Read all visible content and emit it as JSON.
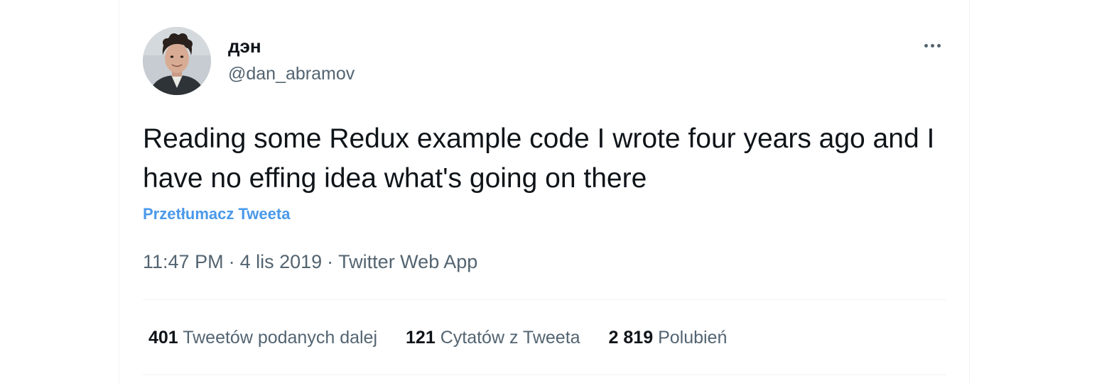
{
  "tweet": {
    "author": {
      "name": "дэн",
      "handle": "@dan_abramov"
    },
    "text": "Reading some Redux example code I wrote four years ago and I have no effing idea what's going on there",
    "translate_label": "Przetłumacz Tweeta",
    "time": "11:47 PM",
    "date": "4 lis 2019",
    "source": "Twitter Web App",
    "separator": "·"
  },
  "stats": {
    "retweets": {
      "count": "401",
      "label": "Tweetów podanych dalej"
    },
    "quotes": {
      "count": "121",
      "label": "Cytatów z Tweeta"
    },
    "likes": {
      "count": "2 819",
      "label": "Polubień"
    }
  },
  "icons": {
    "more": "more-horizontal-icon"
  },
  "colors": {
    "text_primary": "#0f1419",
    "text_secondary": "#536471",
    "link": "#4a99e9",
    "border": "#eff3f4"
  }
}
